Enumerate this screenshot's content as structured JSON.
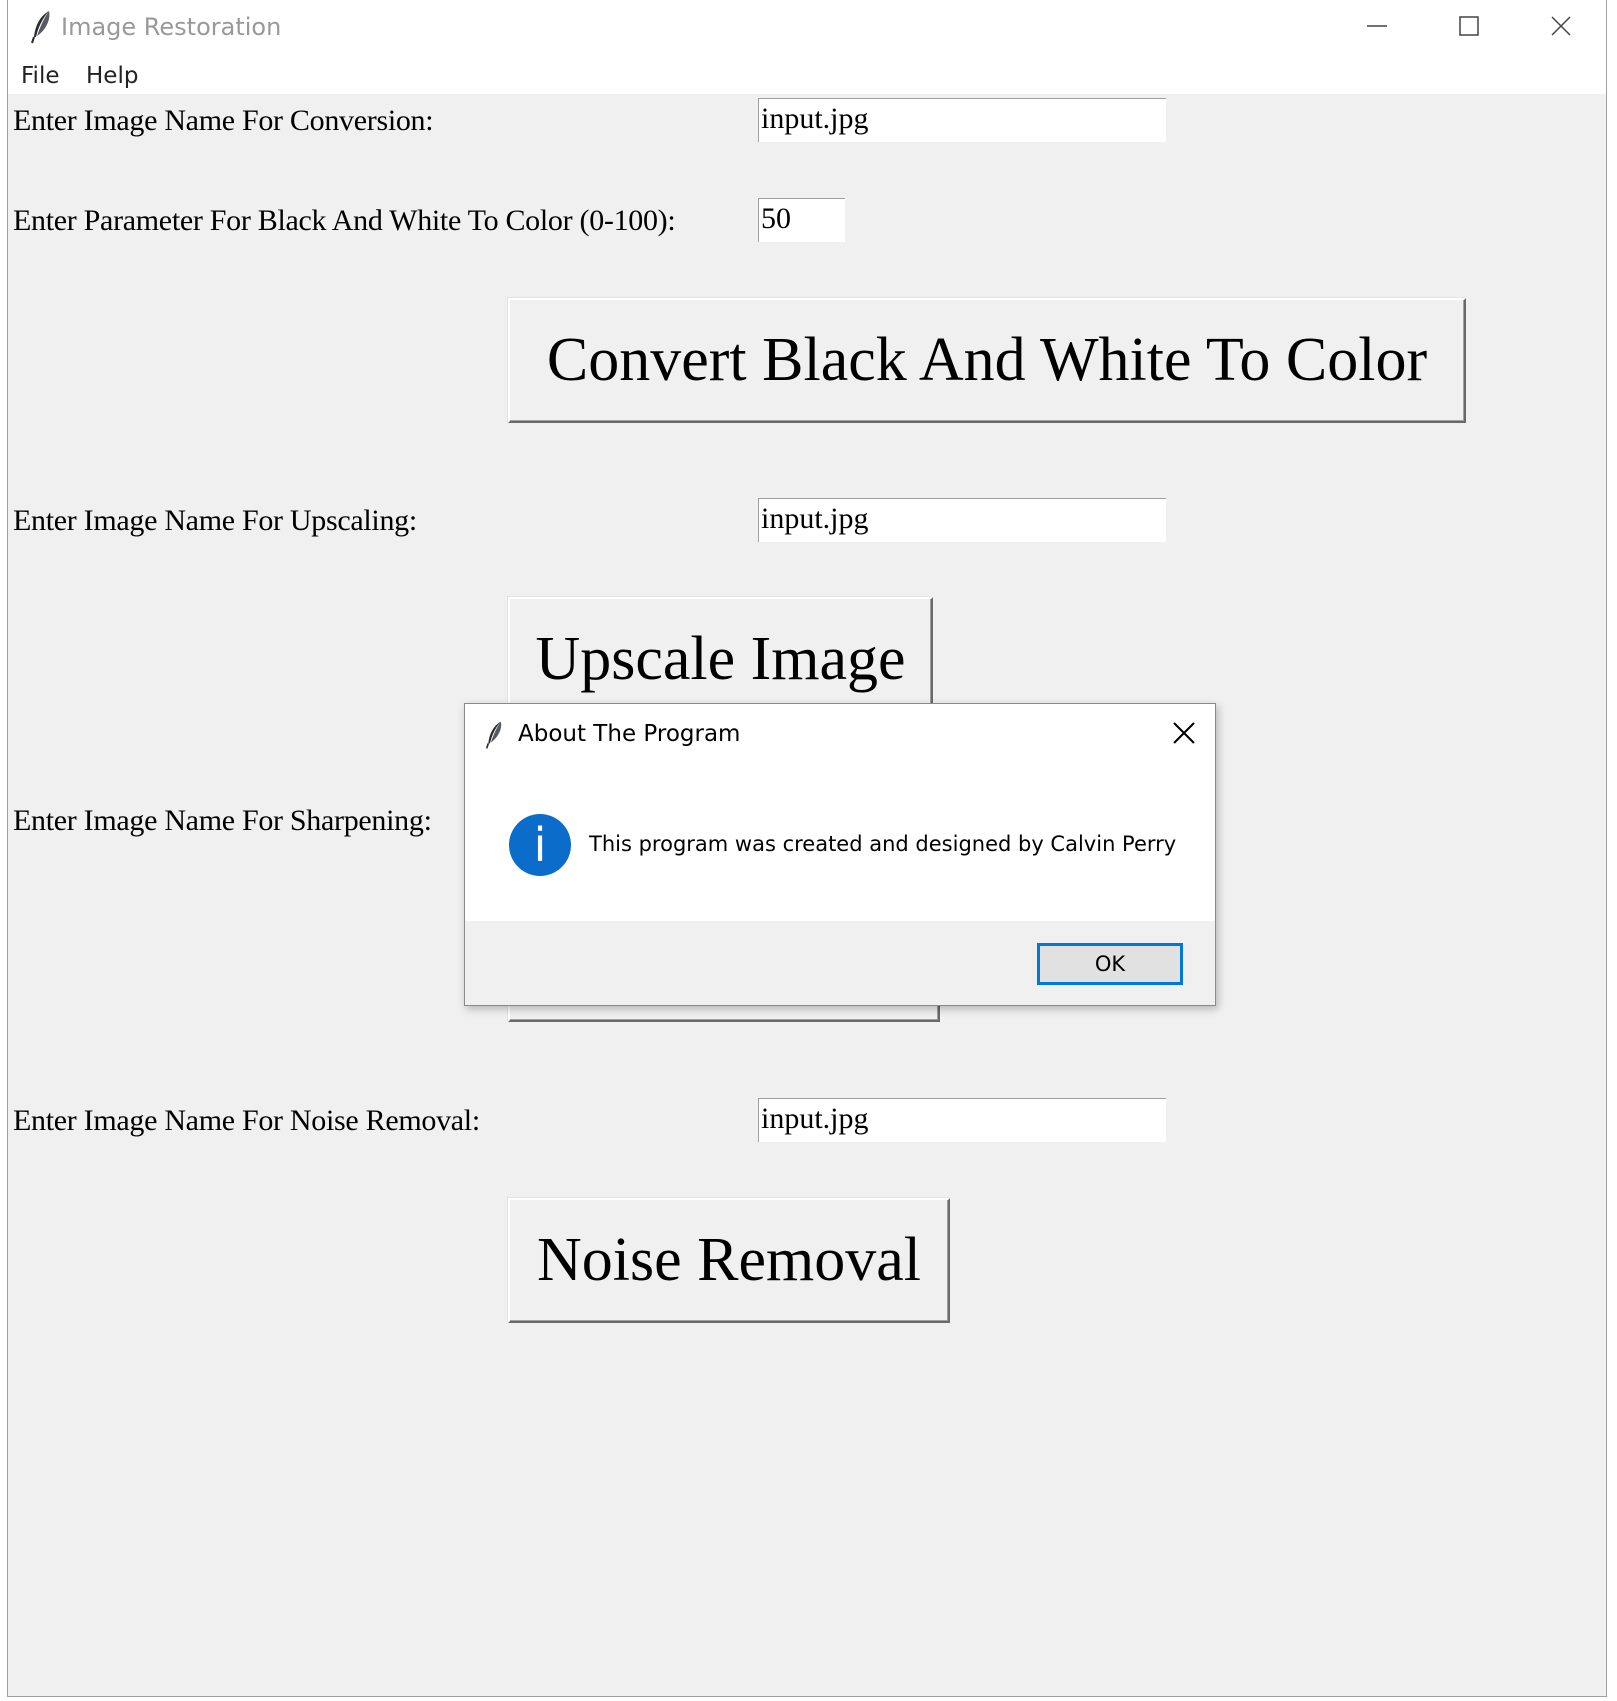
{
  "window": {
    "title": "Image Restoration",
    "icon": "feather-icon"
  },
  "menu": {
    "file": "File",
    "help": "Help"
  },
  "form": {
    "conversion_label": "Enter Image Name For Conversion:",
    "conversion_value": "input.jpg",
    "parameter_label": "Enter Parameter For Black And White To Color (0-100):",
    "parameter_value": "50",
    "convert_button": "Convert Black And White To Color",
    "upscale_label": "Enter Image Name For Upscaling:",
    "upscale_value": "input.jpg",
    "upscale_button": "Upscale Image",
    "sharpen_label": "Enter Image Name For Sharpening:",
    "noise_label": "Enter Image Name For Noise Removal:",
    "noise_value": "input.jpg",
    "noise_button": "Noise Removal"
  },
  "dialog": {
    "title": "About The Program",
    "message": "This program was created and designed by Calvin Perry",
    "ok": "OK",
    "icon": "info-icon",
    "icon_glyph": "i"
  },
  "colors": {
    "window_bg": "#f0f0f0",
    "info_blue": "#0b6cc9",
    "focus_border": "#0078d7"
  }
}
